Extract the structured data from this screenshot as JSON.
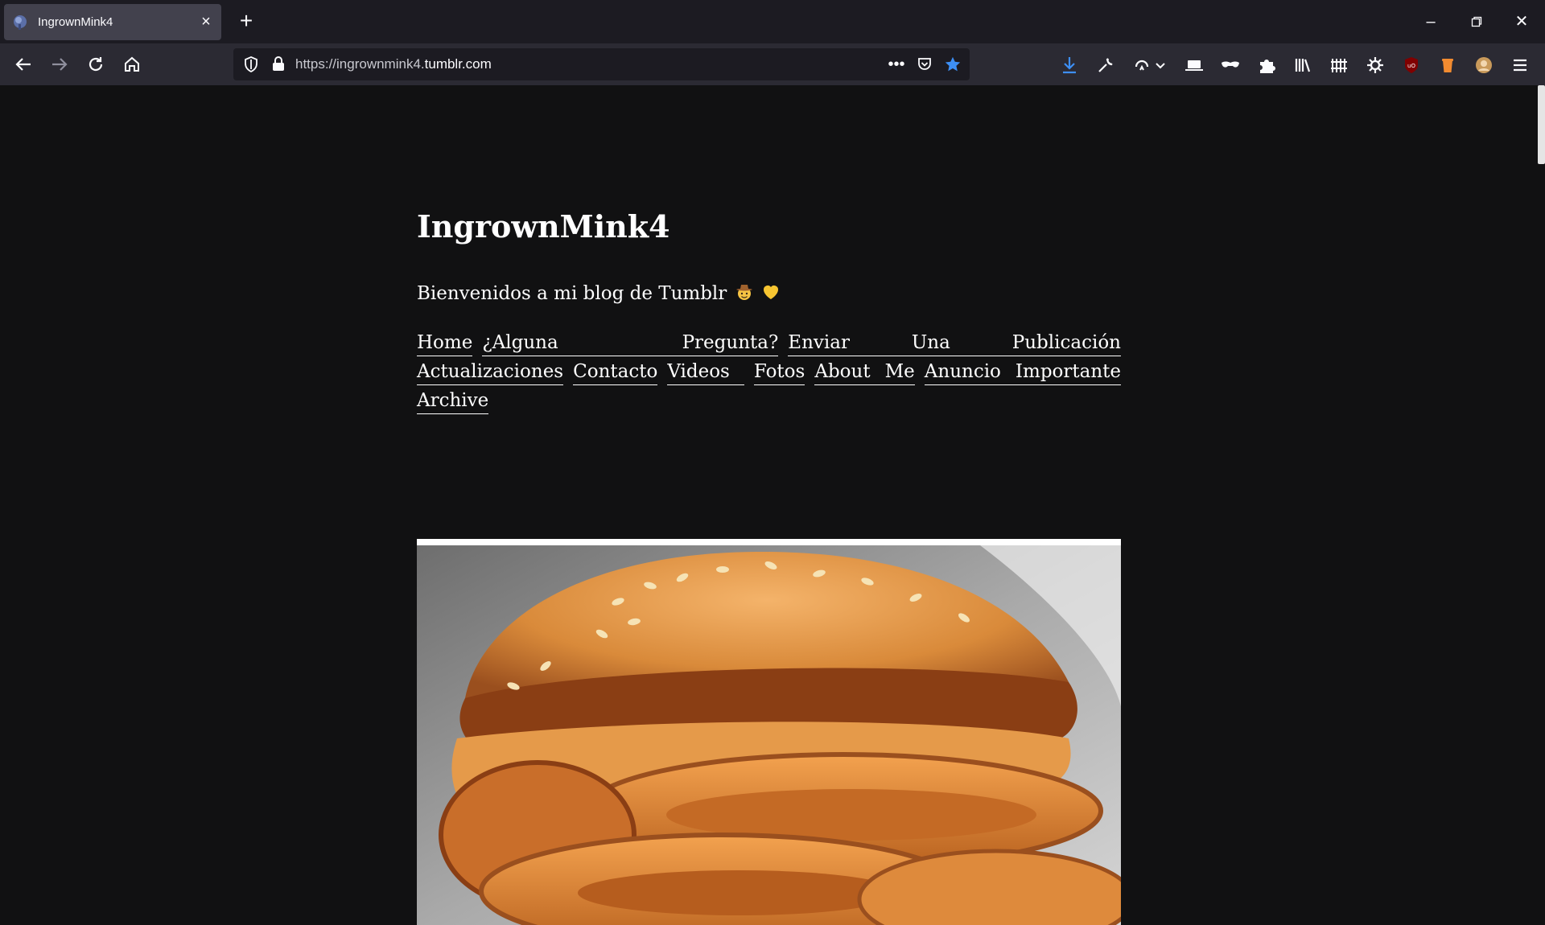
{
  "browser": {
    "tab": {
      "title": "IngrownMink4"
    },
    "url": {
      "prefix": "https://ingrownmink4.",
      "domain": "tumblr.com"
    }
  },
  "blog": {
    "title": "IngrownMink4",
    "description": "Bienvenidos a mi blog de Tumblr",
    "description_emojis": [
      "cowboy-face",
      "yellow-heart"
    ],
    "nav_rows": [
      [
        {
          "id": "home",
          "words": [
            "Home"
          ],
          "grow": false
        },
        {
          "id": "ask",
          "words": [
            "¿Alguna",
            "Pregunta?"
          ],
          "grow": true
        },
        {
          "id": "submit",
          "words": [
            "Enviar",
            "Una",
            "Publicación"
          ],
          "grow": true
        }
      ],
      [
        {
          "id": "updates",
          "words": [
            "Actualizaciones"
          ],
          "grow": false
        },
        {
          "id": "contact",
          "words": [
            "Contacto"
          ],
          "grow": false
        },
        {
          "id": "videos",
          "words": [
            "Videos"
          ],
          "grow": true
        },
        {
          "id": "photos",
          "words": [
            "Fotos"
          ],
          "grow": false
        },
        {
          "id": "about",
          "words": [
            "About",
            "Me"
          ],
          "grow": true
        },
        {
          "id": "notice",
          "words": [
            "Anuncio",
            "Importante"
          ],
          "grow": true
        }
      ],
      [
        {
          "id": "archive",
          "words": [
            "Archive"
          ],
          "grow": false
        }
      ]
    ]
  },
  "colors": {
    "page_background": "#111112",
    "toolbar_background": "#2b2a33",
    "tabstrip_background": "#1c1b22",
    "bookmark_star": "#3d8ff5",
    "download_arrow": "#3d8ff5"
  }
}
